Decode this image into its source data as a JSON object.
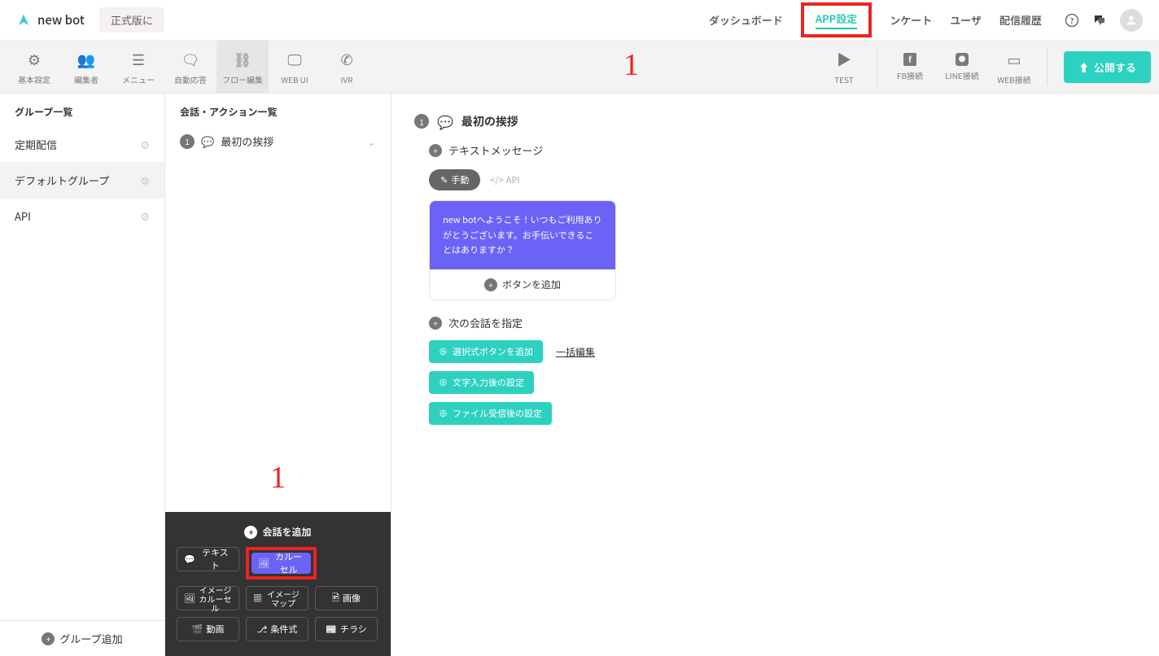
{
  "header": {
    "app_name": "new bot",
    "plan_badge": "正式版に",
    "nav": {
      "dashboard": "ダッシュボード",
      "app_settings": "APP設定",
      "survey": "ンケート",
      "user": "ユーザ",
      "delivery": "配信履歴"
    },
    "annotation_top": "1"
  },
  "toolbar": {
    "items": [
      {
        "label": "基本設定"
      },
      {
        "label": "編集者"
      },
      {
        "label": "メニュー"
      },
      {
        "label": "自動応答"
      },
      {
        "label": "フロー編集"
      },
      {
        "label": "WEB UI"
      },
      {
        "label": "IVR"
      }
    ],
    "right_items": [
      {
        "label": "TEST"
      },
      {
        "label": "FB接続"
      },
      {
        "label": "LINE接続"
      },
      {
        "label": "WEB接続"
      }
    ],
    "publish": "公開する"
  },
  "left": {
    "title": "グループ一覧",
    "groups": [
      {
        "label": "定期配信"
      },
      {
        "label": "デフォルトグループ"
      },
      {
        "label": "API"
      }
    ],
    "add_group": "グループ追加"
  },
  "mid": {
    "title": "会話・アクション一覧",
    "item1_num": "1",
    "item1_label": "最初の挨拶",
    "annotation": "1",
    "add_panel": {
      "title": "会話を追加",
      "buttons": {
        "text": "テキスト",
        "carousel": "カルーセル",
        "image_carousel": "イメージ\nカルーセル",
        "image_map": "イメージ\nマップ",
        "image": "画像",
        "video": "動画",
        "conditional": "条件式",
        "flyer": "チラシ"
      }
    }
  },
  "flow": {
    "step_num": "1",
    "step_title": "最初の挨拶",
    "text_message": "テキストメッセージ",
    "manual": "手動",
    "api": "API",
    "greeting": "new botへようこそ！いつもご利用ありがとうございます。お手伝いできることはありますか？",
    "add_btn": "ボタンを追加",
    "next_section": "次の会話を指定",
    "add_choice": "選択式ボタンを追加",
    "bulk_edit": "一括編集",
    "text_input_settings": "文字入力後の設定",
    "file_receive_settings": "ファイル受信後の設定"
  }
}
